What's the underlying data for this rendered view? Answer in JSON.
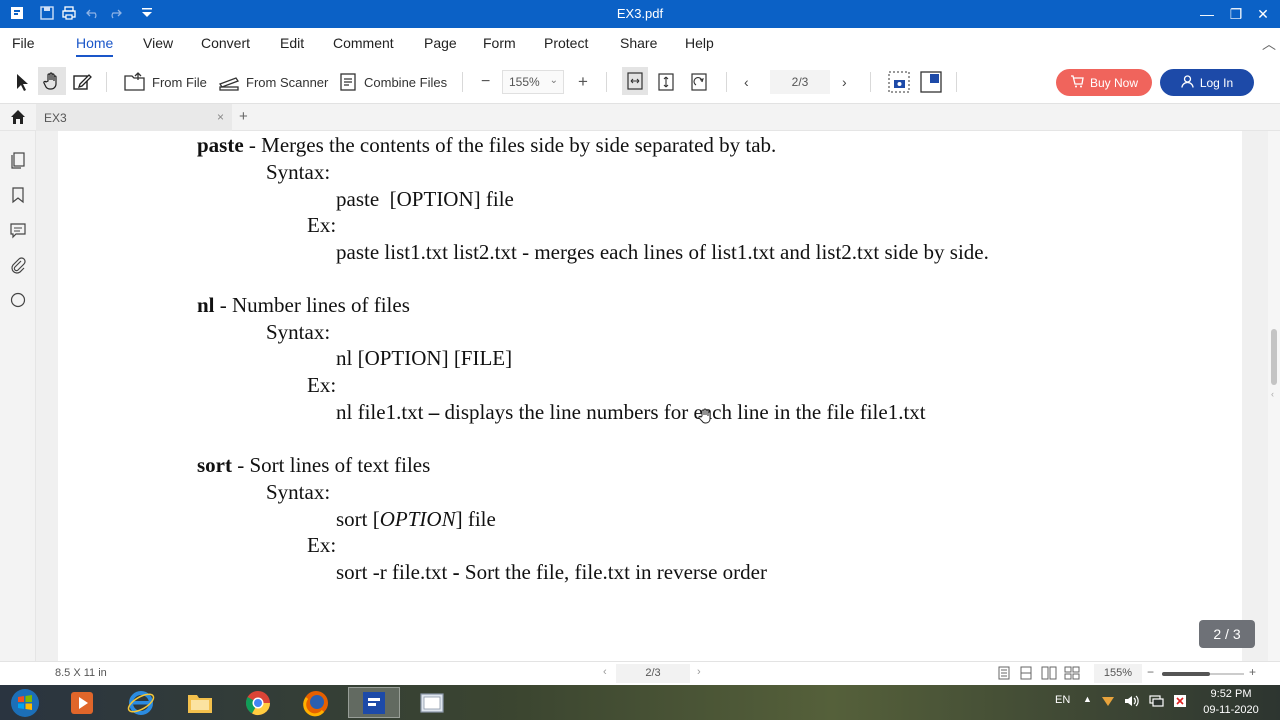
{
  "window": {
    "title": "EX3.pdf"
  },
  "menu": [
    "File",
    "Home",
    "View",
    "Convert",
    "Edit",
    "Comment",
    "Page",
    "Form",
    "Protect",
    "Share",
    "Help"
  ],
  "toolbar": {
    "from_file": "From File",
    "from_scanner": "From Scanner",
    "combine_files": "Combine Files",
    "zoom_minus": "−",
    "zoom_value": "155%",
    "zoom_plus": "+",
    "page_value": "2/3",
    "buy_now": "Buy Now",
    "log_in": "Log In"
  },
  "tab": {
    "name": "EX3",
    "close": "×",
    "add": "+"
  },
  "document": {
    "paste": {
      "cmd": "paste",
      "desc": " - Merges the contents of the files side by side separated by tab.",
      "syntax_label": "Syntax:",
      "syntax": "paste  [OPTION] file",
      "ex_label": "Ex:",
      "ex": "paste list1.txt list2.txt - merges each lines of list1.txt and list2.txt side by side."
    },
    "nl": {
      "cmd": "nl",
      "desc": " - Number lines of files",
      "syntax_label": "Syntax:",
      "syntax": "nl [OPTION] [FILE]",
      "ex_label": "Ex:",
      "ex_a": "nl file1.txt ",
      "ex_dash": "–",
      "ex_b": " displays the line numbers for each line in the file file1.txt"
    },
    "sort": {
      "cmd": "sort",
      "desc": " - Sort lines of text files",
      "syntax_label": "Syntax:",
      "syntax_a": "sort [",
      "syntax_opt": "OPTION",
      "syntax_b": "] file",
      "ex_label": "Ex:",
      "ex_a": "sort -r file.txt ",
      "ex_dash": "-",
      "ex_b": " Sort the file, file.txt in reverse order"
    }
  },
  "page_indicator": "2 / 3",
  "status": {
    "page_size": "8.5 X 11 in",
    "page_nav": "2/3",
    "zoom": "155%",
    "zoom_minus": "−",
    "zoom_plus": "+"
  },
  "taskbar": {
    "lang": "EN",
    "time": "9:52 PM",
    "date": "09-11-2020"
  },
  "colors": {
    "title_bar": "#0b61c6",
    "accent": "#1a56c9",
    "buy": "#f0645c",
    "login": "#1d4aa8"
  }
}
